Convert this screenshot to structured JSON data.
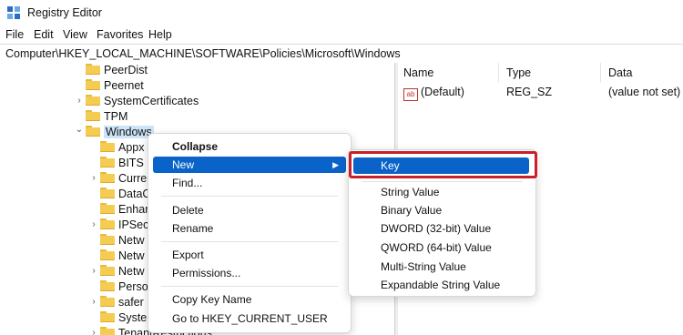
{
  "window": {
    "title": "Registry Editor",
    "icon": "regedit-icon"
  },
  "menubar": [
    "File",
    "Edit",
    "View",
    "Favorites",
    "Help"
  ],
  "address": "Computer\\HKEY_LOCAL_MACHINE\\SOFTWARE\\Policies\\Microsoft\\Windows",
  "tree": {
    "top_items": [
      {
        "label": "PeerDist",
        "expander": ""
      },
      {
        "label": "Peernet",
        "expander": ""
      },
      {
        "label": "SystemCertificates",
        "expander": "›"
      },
      {
        "label": "TPM",
        "expander": ""
      },
      {
        "label": "Windows",
        "expander": "⌄"
      }
    ],
    "children": [
      {
        "label": "Appx",
        "expander": ""
      },
      {
        "label": "BITS",
        "expander": ""
      },
      {
        "label": "Curre",
        "expander": "›"
      },
      {
        "label": "DataC",
        "expander": ""
      },
      {
        "label": "Enhar",
        "expander": ""
      },
      {
        "label": "IPSec",
        "expander": "›"
      },
      {
        "label": "Netw",
        "expander": ""
      },
      {
        "label": "Netw",
        "expander": ""
      },
      {
        "label": "Netw",
        "expander": "›"
      },
      {
        "label": "Perso",
        "expander": ""
      },
      {
        "label": "safer",
        "expander": "›"
      },
      {
        "label": "Syste",
        "expander": ""
      },
      {
        "label": "TenantRestrictions",
        "expander": "›"
      }
    ]
  },
  "values_pane": {
    "columns": [
      "Name",
      "Type",
      "Data"
    ],
    "rows": [
      {
        "name": "(Default)",
        "type": "REG_SZ",
        "data": "(value not set)",
        "icon": "ab"
      }
    ]
  },
  "context_menu": {
    "items": [
      "Collapse",
      "New",
      "Find...",
      "Delete",
      "Rename",
      "Export",
      "Permissions...",
      "Copy Key Name",
      "Go to HKEY_CURRENT_USER"
    ],
    "highlighted": "New"
  },
  "submenu": {
    "items": [
      "Key",
      "String Value",
      "Binary Value",
      "DWORD (32-bit) Value",
      "QWORD (64-bit) Value",
      "Multi-String Value",
      "Expandable String Value"
    ],
    "highlighted": "Key"
  },
  "colors": {
    "highlight": "#0a63c9",
    "annotation_box": "#c8202a",
    "selection": "#cce4f7"
  }
}
